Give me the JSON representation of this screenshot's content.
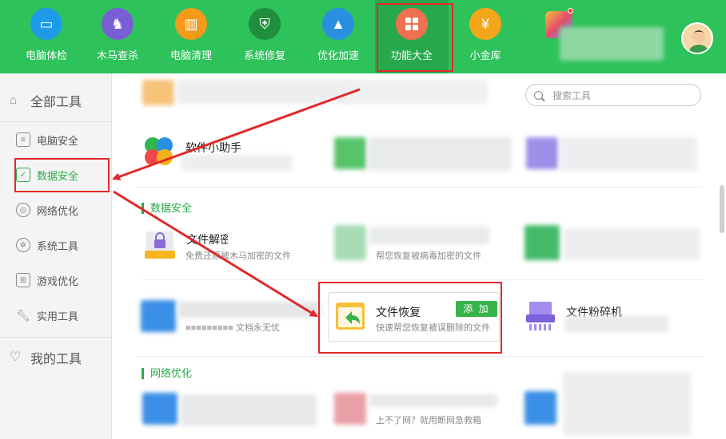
{
  "nav": {
    "items": [
      {
        "label": "电脑体检",
        "icon": "monitor-icon",
        "color": "#1e9be8"
      },
      {
        "label": "木马查杀",
        "icon": "horse-icon",
        "color": "#7a5ed6"
      },
      {
        "label": "电脑清理",
        "icon": "broom-icon",
        "color": "#f39a1a"
      },
      {
        "label": "系统修复",
        "icon": "shield-icon",
        "color": "#1f8f3e"
      },
      {
        "label": "优化加速",
        "icon": "rocket-icon",
        "color": "#2a8fe0"
      },
      {
        "label": "功能大全",
        "icon": "grid-icon",
        "color": "#f07050"
      },
      {
        "label": "小金库",
        "icon": "coin-icon",
        "color": "#f3a61a"
      }
    ],
    "avatar": "user-avatar"
  },
  "sidebar": {
    "all_tools": "全部工具",
    "items": [
      {
        "label": "电脑安全",
        "icon": "screen-icon"
      },
      {
        "label": "数据安全",
        "icon": "data-shield-icon"
      },
      {
        "label": "网络优化",
        "icon": "network-icon"
      },
      {
        "label": "系统工具",
        "icon": "gear-icon"
      },
      {
        "label": "游戏优化",
        "icon": "gamepad-icon"
      },
      {
        "label": "实用工具",
        "icon": "wrench-icon"
      }
    ],
    "my_tools": "我的工具"
  },
  "search": {
    "placeholder": "搜索工具"
  },
  "sections": {
    "data_security": "数据安全",
    "network": "网络优化"
  },
  "tools": {
    "software_helper": {
      "name": "软件小助手"
    },
    "file_decrypt": {
      "name": "文件解密",
      "desc": "免费还原被木马加密的文件"
    },
    "virus_decrypt": {
      "desc": "帮您恢复被病毒加密的文件"
    },
    "file_recover": {
      "name": "文件恢复",
      "desc": "快速帮您恢复被误删除的文件",
      "add": "添 加"
    },
    "file_shredder": {
      "name": "文件粉碎机"
    },
    "doc_guard": {
      "desc": "文档永无忧"
    },
    "net_repair": {
      "desc": "上不了网？就用断网急救箱"
    }
  },
  "colors": {
    "brand": "#2ec25a",
    "accent": "#2aa84a",
    "annotation": "#e02a2a"
  }
}
